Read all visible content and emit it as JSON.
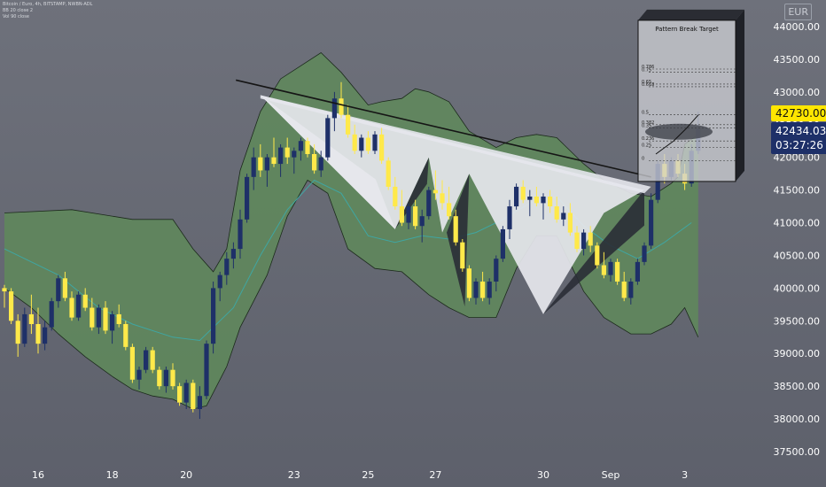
{
  "legend": {
    "line1": "Bitcoin / Euro, 4h, BITSTAMP, NWBN-ADL",
    "line2": "BB 20 close 2",
    "line3": "Vol 90 close"
  },
  "currency": "EUR",
  "price_tag": {
    "label": "42730.00",
    "color": "#ffe600"
  },
  "last_price": {
    "price": "42434.03",
    "countdown": "03:27:26",
    "color": "#1e3068"
  },
  "annotation": {
    "title": "Pattern Break Target",
    "fib_labels": [
      "0.786",
      "0.75",
      "0.65",
      "0.618",
      "0.5",
      "0.382",
      "0.35",
      "0.236",
      "0.25",
      "0"
    ]
  },
  "colors": {
    "background": "#676a74",
    "bull_candle": "#1e3068",
    "bear_candle": "#ffe94a",
    "band_fill": "#5f8a5a",
    "basis_line": "#3fa6a2",
    "pattern_fill": "#e6e7ed",
    "pattern_shadow": "#2a2d36"
  },
  "chart_data": {
    "type": "candlestick",
    "y_axis": {
      "min": 37500,
      "max": 44000,
      "ticks": [
        "44000.00",
        "43500.00",
        "43000.00",
        "42500.00",
        "42000.00",
        "41500.00",
        "41000.00",
        "40500.00",
        "40000.00",
        "39500.00",
        "39000.00",
        "38500.00",
        "38000.00",
        "37500.00"
      ]
    },
    "x_axis": {
      "ticks": [
        "16",
        "18",
        "20",
        "23",
        "25",
        "27",
        "30",
        "Sep",
        "3"
      ]
    },
    "candles": [
      [
        40000,
        40050,
        39700,
        39950
      ],
      [
        39950,
        40000,
        39450,
        39500
      ],
      [
        39500,
        39600,
        38950,
        39150
      ],
      [
        39150,
        39700,
        39100,
        39600
      ],
      [
        39600,
        39900,
        39300,
        39450
      ],
      [
        39450,
        39700,
        39000,
        39150
      ],
      [
        39150,
        39500,
        39050,
        39400
      ],
      [
        39400,
        39850,
        39350,
        39800
      ],
      [
        39800,
        40200,
        39700,
        40150
      ],
      [
        40150,
        40250,
        39800,
        39850
      ],
      [
        39850,
        39950,
        39500,
        39550
      ],
      [
        39550,
        39950,
        39500,
        39900
      ],
      [
        39900,
        40000,
        39650,
        39700
      ],
      [
        39700,
        39850,
        39350,
        39400
      ],
      [
        39400,
        39750,
        39300,
        39700
      ],
      [
        39700,
        39800,
        39300,
        39350
      ],
      [
        39350,
        39650,
        39150,
        39600
      ],
      [
        39600,
        39750,
        39400,
        39450
      ],
      [
        39450,
        39500,
        39050,
        39100
      ],
      [
        39100,
        39150,
        38550,
        38600
      ],
      [
        38600,
        38800,
        38450,
        38750
      ],
      [
        38750,
        39100,
        38700,
        39050
      ],
      [
        39050,
        39100,
        38700,
        38750
      ],
      [
        38750,
        38800,
        38450,
        38500
      ],
      [
        38500,
        38800,
        38400,
        38750
      ],
      [
        38750,
        38850,
        38450,
        38500
      ],
      [
        38500,
        38550,
        38200,
        38250
      ],
      [
        38250,
        38600,
        38150,
        38550
      ],
      [
        38550,
        38600,
        38100,
        38150
      ],
      [
        38150,
        38500,
        38000,
        38350
      ],
      [
        38350,
        39200,
        38300,
        39150
      ],
      [
        39150,
        40100,
        39000,
        40000
      ],
      [
        40000,
        40250,
        39800,
        40200
      ],
      [
        40200,
        40550,
        40050,
        40450
      ],
      [
        40450,
        40700,
        40300,
        40600
      ],
      [
        40600,
        41200,
        40450,
        41050
      ],
      [
        41050,
        41750,
        41000,
        41700
      ],
      [
        41700,
        42150,
        41500,
        42000
      ],
      [
        42000,
        42200,
        41700,
        41800
      ],
      [
        41800,
        42050,
        41550,
        42000
      ],
      [
        42000,
        42300,
        41850,
        41900
      ],
      [
        41900,
        42200,
        41700,
        42150
      ],
      [
        42150,
        42300,
        41900,
        42000
      ],
      [
        42000,
        42150,
        41750,
        42100
      ],
      [
        42100,
        42300,
        41950,
        42250
      ],
      [
        42250,
        42300,
        42000,
        42050
      ],
      [
        42050,
        42200,
        41750,
        41800
      ],
      [
        41800,
        42100,
        41700,
        42000
      ],
      [
        42000,
        42650,
        41950,
        42600
      ],
      [
        42600,
        43000,
        42400,
        42900
      ],
      [
        42900,
        43150,
        42600,
        42650
      ],
      [
        42650,
        42800,
        42300,
        42350
      ],
      [
        42350,
        42500,
        42050,
        42100
      ],
      [
        42100,
        42350,
        42000,
        42300
      ],
      [
        42300,
        42400,
        42050,
        42100
      ],
      [
        42100,
        42400,
        42050,
        42350
      ],
      [
        42350,
        42450,
        41900,
        41950
      ],
      [
        41950,
        42000,
        41500,
        41550
      ],
      [
        41550,
        41700,
        41200,
        41250
      ],
      [
        41250,
        41500,
        40950,
        41000
      ],
      [
        41000,
        41300,
        40900,
        41250
      ],
      [
        41250,
        41350,
        40900,
        40950
      ],
      [
        40950,
        41200,
        40700,
        41100
      ],
      [
        41100,
        41550,
        41050,
        41500
      ],
      [
        41500,
        41800,
        41350,
        41450
      ],
      [
        41450,
        41650,
        41200,
        41300
      ],
      [
        41300,
        41550,
        41050,
        41100
      ],
      [
        41100,
        41200,
        40650,
        40700
      ],
      [
        40700,
        40750,
        40250,
        40300
      ],
      [
        40300,
        40350,
        39800,
        39850
      ],
      [
        39850,
        40150,
        39750,
        40100
      ],
      [
        40100,
        40250,
        39800,
        39850
      ],
      [
        39850,
        40150,
        39750,
        40100
      ],
      [
        40100,
        40500,
        39950,
        40450
      ],
      [
        40450,
        40950,
        40400,
        40900
      ],
      [
        40900,
        41350,
        40750,
        41250
      ],
      [
        41250,
        41600,
        41200,
        41550
      ],
      [
        41550,
        41650,
        41300,
        41350
      ],
      [
        41350,
        41500,
        41100,
        41400
      ],
      [
        41400,
        41550,
        41250,
        41300
      ],
      [
        41300,
        41450,
        41050,
        41400
      ],
      [
        41400,
        41500,
        41150,
        41250
      ],
      [
        41250,
        41400,
        41000,
        41050
      ],
      [
        41050,
        41250,
        40950,
        41150
      ],
      [
        41150,
        41300,
        40800,
        40850
      ],
      [
        40850,
        40950,
        40550,
        40600
      ],
      [
        40600,
        40900,
        40500,
        40850
      ],
      [
        40850,
        40950,
        40550,
        40650
      ],
      [
        40650,
        40700,
        40300,
        40350
      ],
      [
        40350,
        40550,
        40150,
        40200
      ],
      [
        40200,
        40450,
        40100,
        40400
      ],
      [
        40400,
        40450,
        40050,
        40100
      ],
      [
        40100,
        40250,
        39800,
        39850
      ],
      [
        39850,
        40150,
        39750,
        40100
      ],
      [
        40100,
        40450,
        40050,
        40400
      ],
      [
        40400,
        40700,
        40350,
        40650
      ],
      [
        40650,
        41450,
        40600,
        41350
      ],
      [
        41350,
        41950,
        41300,
        41900
      ],
      [
        41900,
        42050,
        41600,
        41700
      ],
      [
        41700,
        42000,
        41650,
        41950
      ],
      [
        41950,
        42050,
        41700,
        41750
      ],
      [
        41750,
        41900,
        41500,
        41600
      ],
      [
        41600,
        42200,
        41550,
        42100
      ],
      [
        42100,
        42700,
        42050,
        42434
      ]
    ],
    "bb_upper": [
      [
        0,
        41150
      ],
      [
        10,
        41200
      ],
      [
        19,
        41050
      ],
      [
        25,
        41050
      ],
      [
        28,
        40600
      ],
      [
        31,
        40250
      ],
      [
        33,
        40600
      ],
      [
        35,
        41800
      ],
      [
        38,
        42700
      ],
      [
        41,
        43200
      ],
      [
        44,
        43400
      ],
      [
        47,
        43600
      ],
      [
        50,
        43300
      ],
      [
        54,
        42800
      ],
      [
        56,
        42850
      ],
      [
        59,
        42900
      ],
      [
        61,
        43050
      ],
      [
        63,
        43000
      ],
      [
        66,
        42850
      ],
      [
        69,
        42400
      ],
      [
        73,
        42150
      ],
      [
        76,
        42300
      ],
      [
        79,
        42350
      ],
      [
        82,
        42300
      ],
      [
        86,
        41900
      ],
      [
        89,
        41650
      ],
      [
        93,
        41450
      ],
      [
        96,
        41400
      ],
      [
        99,
        41600
      ],
      [
        100,
        41700
      ],
      [
        101,
        42200
      ],
      [
        103,
        42350
      ]
    ],
    "bb_lower": [
      [
        0,
        40000
      ],
      [
        4,
        39700
      ],
      [
        8,
        39300
      ],
      [
        12,
        38950
      ],
      [
        16,
        38650
      ],
      [
        19,
        38450
      ],
      [
        22,
        38350
      ],
      [
        25,
        38300
      ],
      [
        28,
        38150
      ],
      [
        30,
        38200
      ],
      [
        33,
        38800
      ],
      [
        35,
        39400
      ],
      [
        39,
        40200
      ],
      [
        42,
        41100
      ],
      [
        45,
        41650
      ],
      [
        48,
        41450
      ],
      [
        51,
        40600
      ],
      [
        55,
        40300
      ],
      [
        59,
        40250
      ],
      [
        63,
        39900
      ],
      [
        66,
        39700
      ],
      [
        69,
        39550
      ],
      [
        73,
        39550
      ],
      [
        76,
        40300
      ],
      [
        79,
        40800
      ],
      [
        82,
        40800
      ],
      [
        86,
        39950
      ],
      [
        89,
        39550
      ],
      [
        93,
        39300
      ],
      [
        96,
        39300
      ],
      [
        99,
        39450
      ],
      [
        101,
        39700
      ],
      [
        103,
        39250
      ]
    ],
    "bb_basis": [
      [
        0,
        40600
      ],
      [
        8,
        40200
      ],
      [
        14,
        39700
      ],
      [
        19,
        39450
      ],
      [
        25,
        39250
      ],
      [
        29,
        39200
      ],
      [
        34,
        39700
      ],
      [
        38,
        40500
      ],
      [
        42,
        41200
      ],
      [
        46,
        41650
      ],
      [
        50,
        41450
      ],
      [
        54,
        40800
      ],
      [
        58,
        40700
      ],
      [
        62,
        40800
      ],
      [
        66,
        40750
      ],
      [
        70,
        40850
      ],
      [
        74,
        41050
      ],
      [
        78,
        41300
      ],
      [
        82,
        41400
      ],
      [
        86,
        40950
      ],
      [
        90,
        40650
      ],
      [
        94,
        40450
      ],
      [
        98,
        40700
      ],
      [
        102,
        41000
      ]
    ],
    "trendline": [
      [
        42,
        43100
      ],
      [
        96,
        41700
      ]
    ],
    "pattern_points": [
      [
        38,
        42950
      ],
      [
        58,
        40900
      ],
      [
        63,
        42000
      ],
      [
        65,
        40850
      ],
      [
        69,
        41750
      ],
      [
        80,
        39600
      ],
      [
        89,
        41150
      ],
      [
        95,
        41500
      ]
    ],
    "target_box": {
      "price_top": 43500,
      "price_bottom": 41550,
      "fib_levels": [
        43350,
        43300,
        43120,
        43080,
        42650,
        42500,
        42450,
        42250,
        42150,
        41950
      ],
      "target": 42730
    }
  }
}
